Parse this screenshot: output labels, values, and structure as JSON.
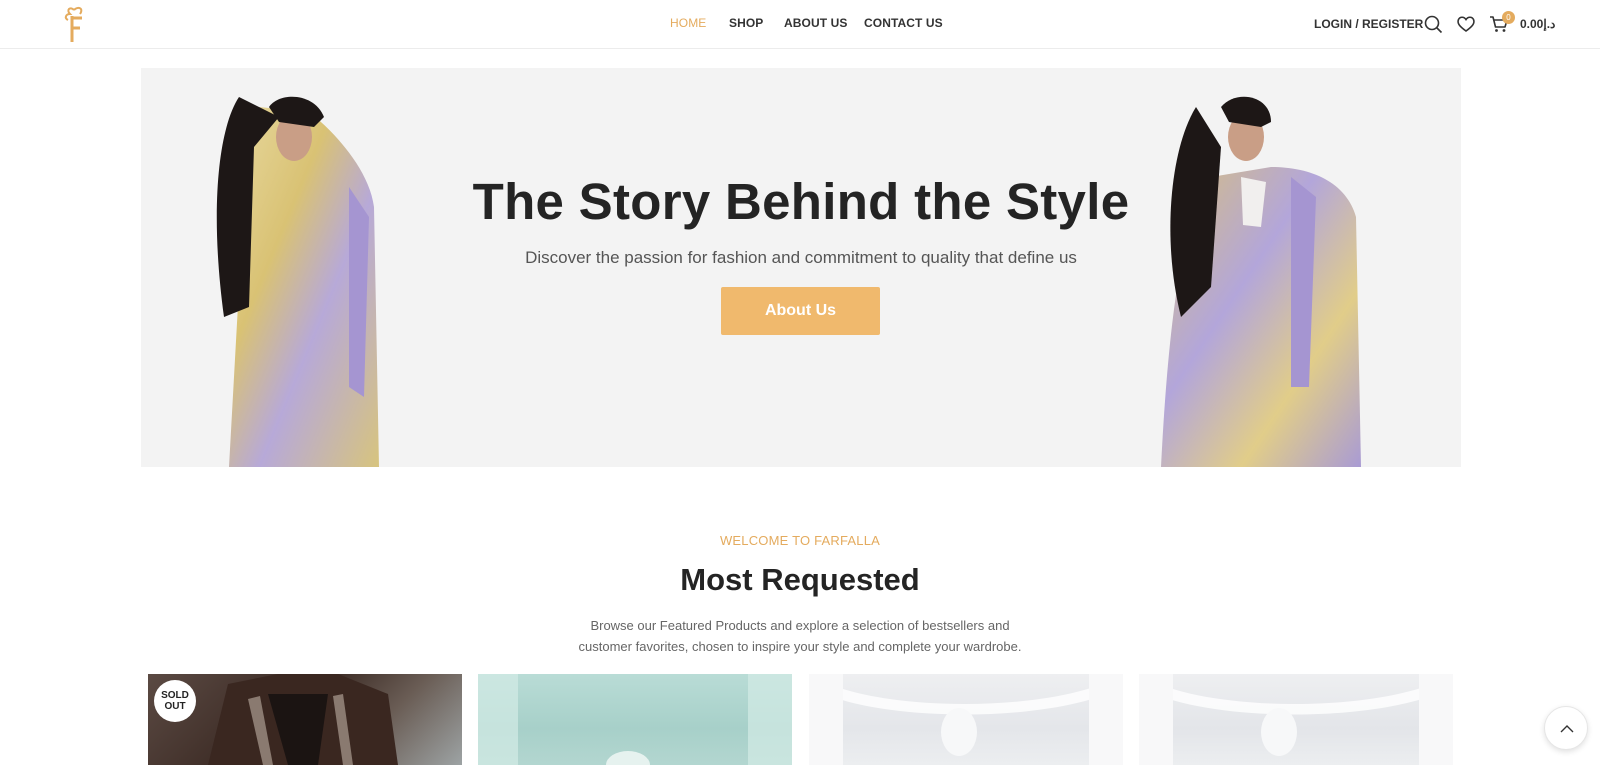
{
  "header": {
    "nav": [
      {
        "label": "HOME",
        "active": true
      },
      {
        "label": "SHOP",
        "active": false
      },
      {
        "label": "ABOUT US",
        "active": false
      },
      {
        "label": "CONTACT US",
        "active": false
      }
    ],
    "login_label": "LOGIN / REGISTER",
    "cart_count": "0",
    "cart_total": "0.00د.إ",
    "icons": [
      "logo-icon",
      "search-icon",
      "heart-icon",
      "cart-icon"
    ]
  },
  "hero": {
    "title": "The Story Behind the Style",
    "subtitle": "Discover the passion for fashion and commitment to quality that define us",
    "button_label": "About Us"
  },
  "section": {
    "kicker": "WELCOME TO FARFALLA",
    "title": "Most Requested",
    "description_line1": "Browse our Featured Products and explore a selection of bestsellers and",
    "description_line2": "customer favorites, chosen to inspire your style and complete your wardrobe."
  },
  "products": [
    {
      "badge_line1": "SOLD",
      "badge_line2": "OUT"
    },
    {},
    {},
    {}
  ],
  "colors": {
    "accent": "#e4ab5e",
    "button": "#f0b96d",
    "hero_bg": "#f3f3f3",
    "text": "#242424"
  }
}
